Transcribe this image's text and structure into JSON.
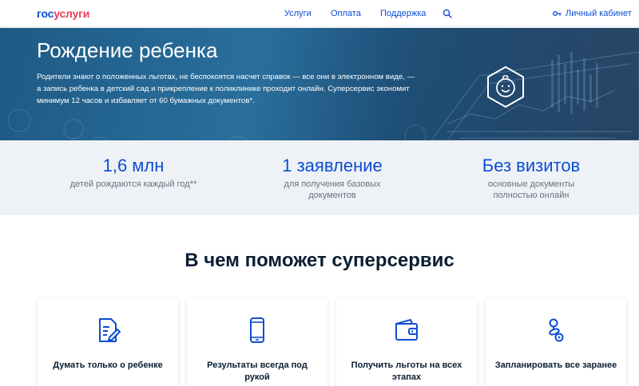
{
  "header": {
    "logo_gos": "гос",
    "logo_uslugi": "услуги",
    "nav": [
      "Услуги",
      "Оплата",
      "Поддержка"
    ],
    "search_icon": "search-icon",
    "cabinet_label": "Личный кабинет",
    "cabinet_icon": "key-icon"
  },
  "hero": {
    "title": "Рождение ребенка",
    "description": "Родители знают о положенных льготах, не беспокоятся насчет справок — все они в электронном виде, — а запись ребенка в детский сад и прикрепление к поликлинике проходит онлайн. Суперсервис экономит минимум 12 часов и избавляет от 60 бумажных документов*.",
    "badge_icon": "baby-face-icon"
  },
  "stats": [
    {
      "value": "1,6 млн",
      "label": "детей рождаются каждый год**"
    },
    {
      "value": "1 заявление",
      "label": "для получения базовых документов"
    },
    {
      "value": "Без визитов",
      "label": "основные документы полностью онлайн"
    }
  ],
  "section": {
    "title": "В чем поможет суперсервис"
  },
  "cards": [
    {
      "label": "Думать только о ребенке",
      "icon": "document-edit-icon"
    },
    {
      "label": "Результаты всегда под рукой",
      "icon": "smartphone-icon"
    },
    {
      "label": "Получить льготы на всех этапах",
      "icon": "wallet-icon"
    },
    {
      "label": "Запланировать все заранее",
      "icon": "baby-pacifier-icon"
    }
  ],
  "colors": {
    "brand_blue": "#0d4cd3",
    "brand_red": "#ee3f58",
    "hero_bg": "#1f5a85",
    "stats_bg": "#eef2f7"
  }
}
